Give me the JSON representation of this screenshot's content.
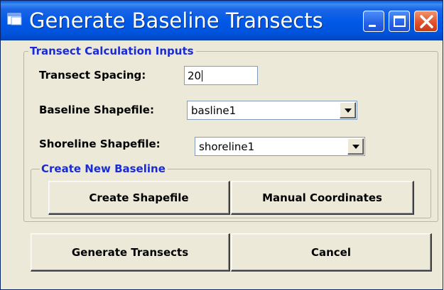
{
  "window": {
    "title": "Generate Baseline Transects"
  },
  "inputs_group": {
    "title": "Transect Calculation Inputs",
    "transect_spacing": {
      "label": "Transect Spacing:",
      "value": "20"
    },
    "baseline_shapefile": {
      "label": "Baseline Shapefile:",
      "value": "basline1"
    },
    "shoreline_shapefile": {
      "label": "Shoreline Shapefile:",
      "value": "shoreline1"
    }
  },
  "baseline_group": {
    "title": "Create New Baseline",
    "create_shapefile_label": "Create Shapefile",
    "manual_coordinates_label": "Manual Coordinates"
  },
  "actions": {
    "generate_label": "Generate Transects",
    "cancel_label": "Cancel"
  },
  "icons": {
    "app": "window-app-icon",
    "minimize": "minimize-icon",
    "maximize": "maximize-icon",
    "close": "close-icon",
    "dropdown": "chevron-down-icon"
  },
  "colors": {
    "titlebar": "#0054e3",
    "close_button": "#e2522b",
    "group_title": "#1a2bd6",
    "face": "#ece9d8"
  }
}
